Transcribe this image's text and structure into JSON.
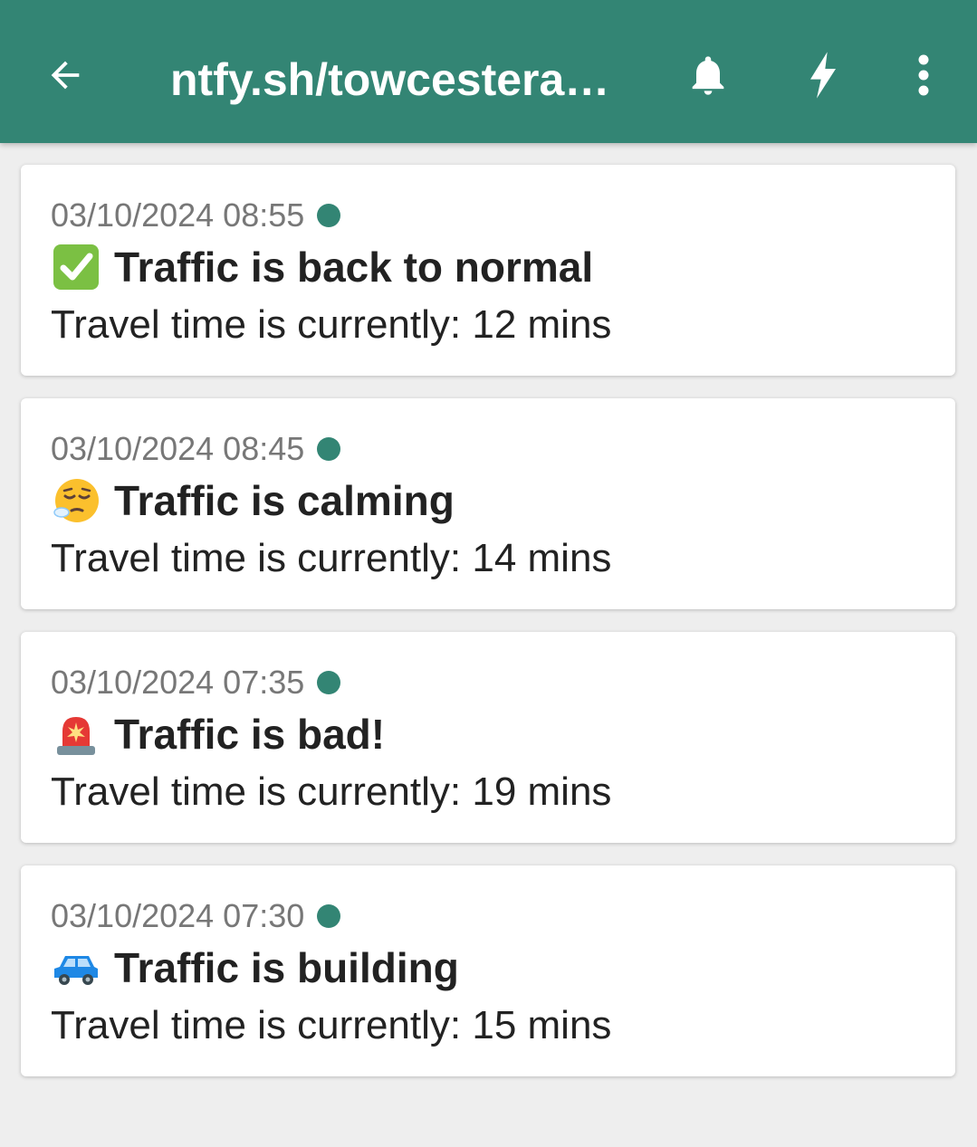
{
  "appbar": {
    "title": "ntfy.sh/towcestera…",
    "background_color": "#338574",
    "icons": [
      "back-arrow-icon",
      "bell-icon",
      "bolt-icon",
      "more-vert-icon"
    ]
  },
  "accent_color": "#338574",
  "notifications": [
    {
      "time": "03/10/2024 08:55",
      "emoji": "check-mark-button-icon",
      "title": "Traffic is back to normal",
      "message": "Travel time is currently: 12 mins"
    },
    {
      "time": "03/10/2024 08:45",
      "emoji": "face-exhaling-icon",
      "title": "Traffic is calming",
      "message": "Travel time is currently: 14 mins"
    },
    {
      "time": "03/10/2024 07:35",
      "emoji": "police-light-icon",
      "title": "Traffic is bad!",
      "message": "Travel time is currently: 19 mins"
    },
    {
      "time": "03/10/2024 07:30",
      "emoji": "suv-car-icon",
      "title": "Traffic is building",
      "message": "Travel time is currently: 15 mins"
    }
  ]
}
